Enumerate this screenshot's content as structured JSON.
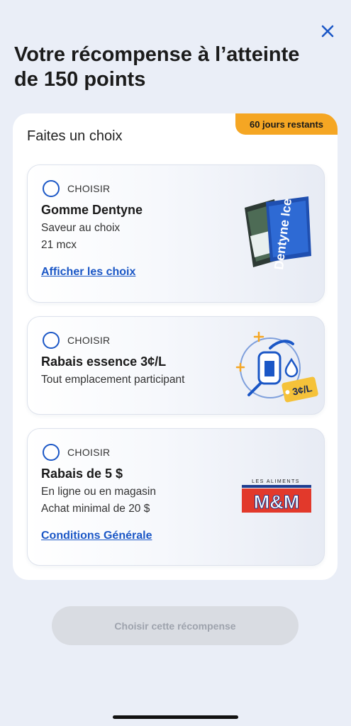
{
  "header": {
    "title": "Votre récompense à l’atteinte de 150 points",
    "close_icon": "close-icon"
  },
  "panel": {
    "heading": "Faites un choix",
    "badge": "60 jours restants"
  },
  "colors": {
    "accent": "#1b57c6",
    "badge": "#f5a623",
    "background": "#eaeef7"
  },
  "options": [
    {
      "choose_label": "CHOISIR",
      "title": "Gomme Dentyne",
      "line1": "Saveur au choix",
      "line2": "21 mcx",
      "link": "Afficher les choix",
      "image": "dentyne-gum-image",
      "image_text": "Dentyne Ice"
    },
    {
      "choose_label": "CHOISIR",
      "title": "Rabais essence 3¢/L",
      "line1": "Tout emplacement participant",
      "image": "fuel-nozzle-icon",
      "image_text": "3¢/L"
    },
    {
      "choose_label": "CHOISIR",
      "title": "Rabais de 5 $",
      "line1": "En ligne ou en magasin",
      "line2": "Achat minimal de 20 $",
      "link": "Conditions Générale",
      "image": "mm-logo",
      "logo_top": "LES ALIMENTS",
      "logo_main": "M&M"
    }
  ],
  "footer": {
    "button_label": "Choisir cette récompense"
  }
}
